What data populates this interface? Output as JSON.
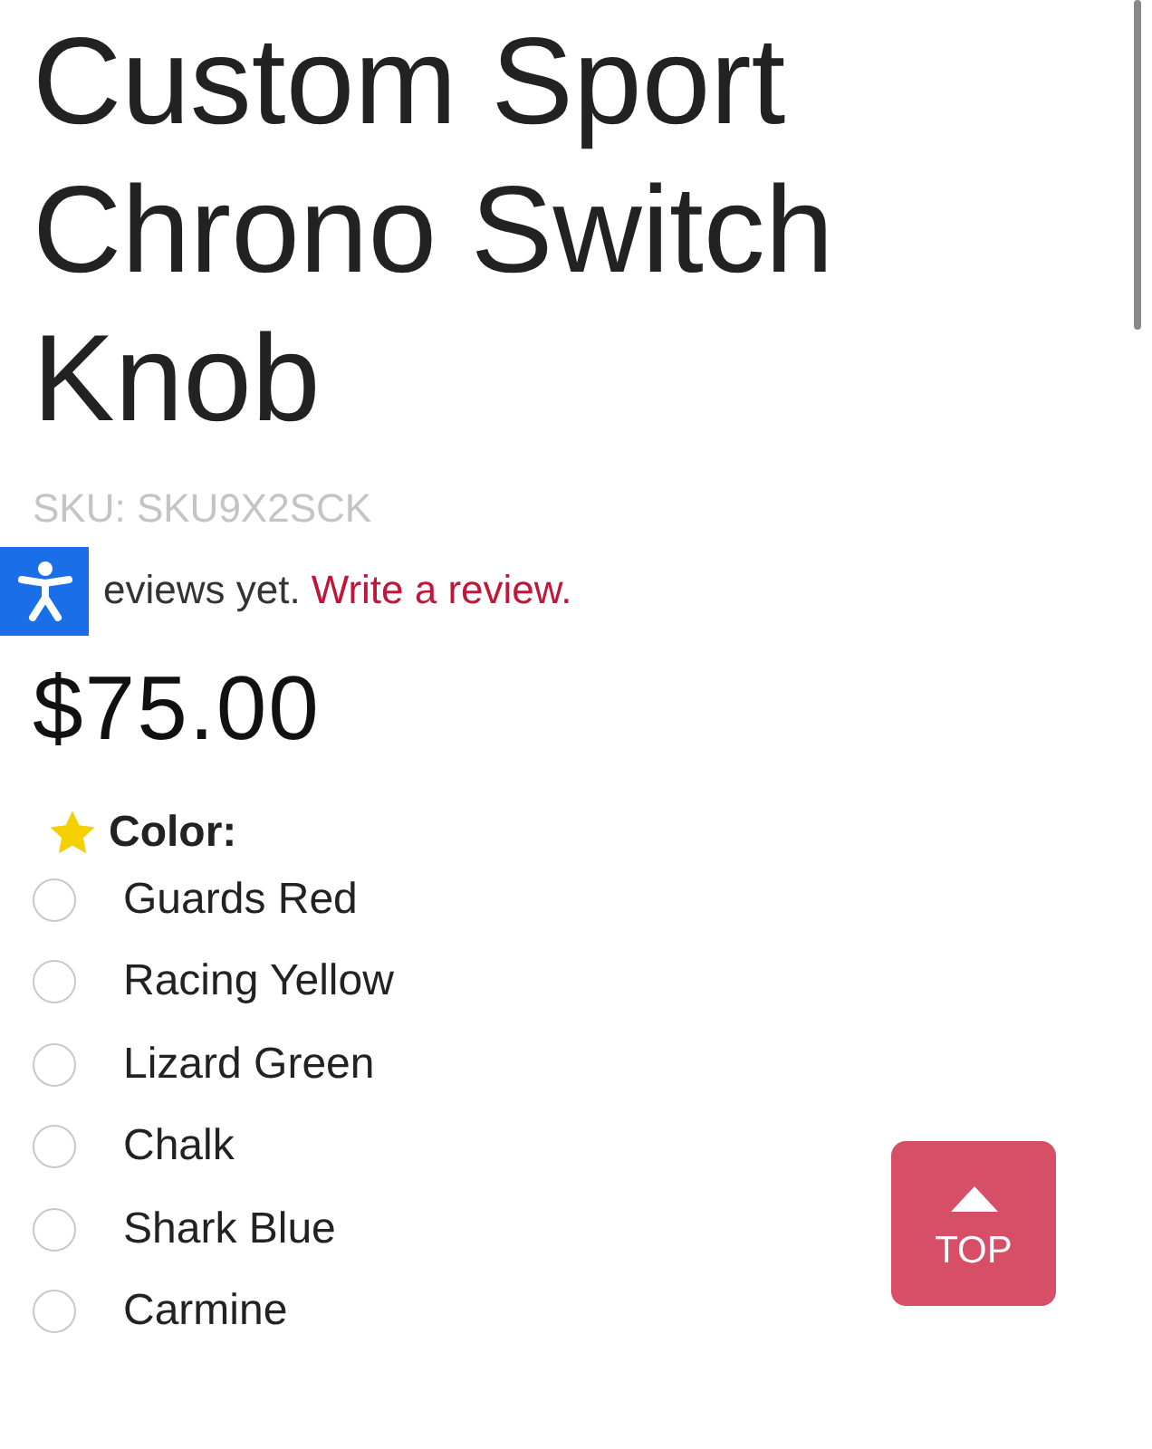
{
  "product": {
    "title": "Custom Sport Chrono Switch Knob",
    "sku": "SKU: SKU9X2SCK",
    "reviews_text": "eviews yet.",
    "review_link": "Write a review.",
    "price": "$75.00"
  },
  "option": {
    "label": "Color:",
    "required": true,
    "choices": [
      {
        "label": "Guards Red",
        "selected": false
      },
      {
        "label": "Racing Yellow",
        "selected": false
      },
      {
        "label": "Lizard Green",
        "selected": false
      },
      {
        "label": "Chalk",
        "selected": false
      },
      {
        "label": "Shark Blue",
        "selected": false
      },
      {
        "label": "Carmine",
        "selected": false
      }
    ]
  },
  "top_button": {
    "label": "TOP"
  }
}
